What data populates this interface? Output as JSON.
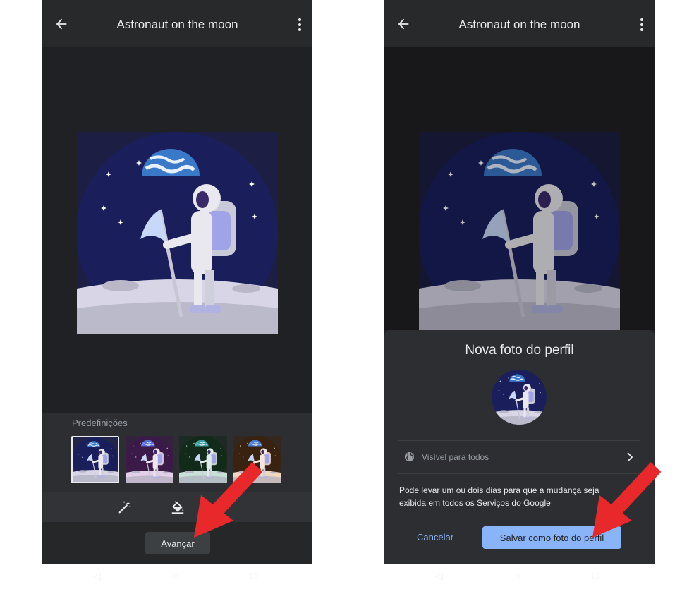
{
  "left": {
    "title": "Astronaut on the moon",
    "presets_label": "Predefinições",
    "presets": [
      {
        "name": "preset-1",
        "sky": "#1a1f5c",
        "ground": "#d8d6e6",
        "suit": "#e8e8ee",
        "moon": "#3a78c8"
      },
      {
        "name": "preset-2",
        "sky": "#3b1a4a",
        "ground": "#e4cfe8",
        "suit": "#f1e4f1",
        "moon": "#5a6ad8"
      },
      {
        "name": "preset-3",
        "sky": "#122a1a",
        "ground": "#c8e0d8",
        "suit": "#e0ece8",
        "moon": "#3aa0a0"
      },
      {
        "name": "preset-4",
        "sky": "#3a2210",
        "ground": "#f0d8c0",
        "suit": "#f4e6dc",
        "moon": "#4a7ad0"
      }
    ],
    "next_label": "Avançar"
  },
  "right": {
    "title": "Astronaut on the moon",
    "sheet_title": "Nova foto do perfil",
    "visibility_label": "Visível para todos",
    "info_text": "Pode levar um ou dois dias para que a mudança seja exibida em todos os Serviços do Google",
    "cancel_label": "Cancelar",
    "save_label": "Salvar como foto do perfil"
  },
  "colors": {
    "accent": "#8ab4f8",
    "arrow": "#e8282b",
    "background": "#202124"
  },
  "icons": [
    "back-arrow-icon",
    "more-vert-icon",
    "magic-wand-icon",
    "paint-bucket-icon",
    "globe-icon",
    "chevron-right-icon"
  ]
}
